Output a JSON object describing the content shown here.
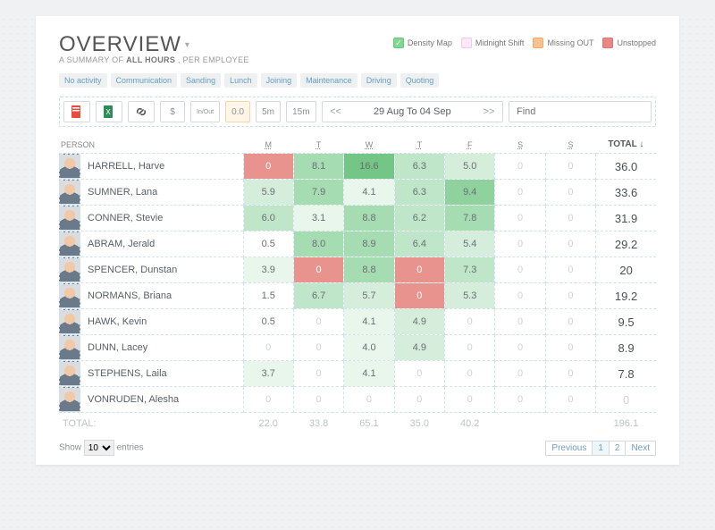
{
  "header": {
    "title": "OVERVIEW",
    "subtitle_pre": "A SUMMARY OF ",
    "subtitle_bold": "ALL HOURS",
    "subtitle_post": ", PER EMPLOYEE"
  },
  "legend": {
    "density": "Density Map",
    "midnight": "Midnight Shift",
    "missing": "Missing OUT",
    "unstopped": "Unstopped"
  },
  "chips": [
    "No activity",
    "Communication",
    "Sanding",
    "Lunch",
    "Joining",
    "Maintenance",
    "Driving",
    "Quoting"
  ],
  "toolbar": {
    "currency": "$",
    "inout": "In/Out",
    "zero": "0.0",
    "five": "5m",
    "fifteen": "15m",
    "prev": "<<",
    "range": "29 Aug To 04 Sep",
    "next": ">>",
    "find_placeholder": "Find"
  },
  "table": {
    "person_header": "PERSON",
    "days": [
      "M",
      "T",
      "W",
      "T",
      "F",
      "S",
      "S"
    ],
    "total_header": "TOTAL",
    "rows": [
      {
        "name": "HARRELL, Harve",
        "cells": [
          "0",
          "8.1",
          "16.6",
          "6.3",
          "5.0",
          "0",
          "0"
        ],
        "flags": [
          "neg",
          "g4",
          "g6",
          "g3",
          "g2",
          "z",
          "z"
        ],
        "total": "36.0"
      },
      {
        "name": "SUMNER, Lana",
        "cells": [
          "5.9",
          "7.9",
          "4.1",
          "6.3",
          "9.4",
          "0",
          "0"
        ],
        "flags": [
          "g2",
          "g4",
          "g1",
          "g3",
          "g5",
          "z",
          "z"
        ],
        "total": "33.6"
      },
      {
        "name": "CONNER, Stevie",
        "cells": [
          "6.0",
          "3.1",
          "8.8",
          "6.2",
          "7.8",
          "0",
          "0"
        ],
        "flags": [
          "g3",
          "g1",
          "g4",
          "g3",
          "g4",
          "z",
          "z"
        ],
        "total": "31.9"
      },
      {
        "name": "ABRAM, Jerald",
        "cells": [
          "0.5",
          "8.0",
          "8.9",
          "6.4",
          "5.4",
          "0",
          "0"
        ],
        "flags": [
          "",
          "g4",
          "g4",
          "g3",
          "g2",
          "z",
          "z"
        ],
        "total": "29.2"
      },
      {
        "name": "SPENCER, Dunstan",
        "cells": [
          "3.9",
          "0",
          "8.8",
          "0",
          "7.3",
          "0",
          "0"
        ],
        "flags": [
          "g1",
          "neg",
          "g4",
          "neg",
          "g3",
          "z",
          "z"
        ],
        "total": "20"
      },
      {
        "name": "NORMANS, Briana",
        "cells": [
          "1.5",
          "6.7",
          "5.7",
          "0",
          "5.3",
          "0",
          "0"
        ],
        "flags": [
          "",
          "g3",
          "g2",
          "neg",
          "g2",
          "z",
          "z"
        ],
        "total": "19.2"
      },
      {
        "name": "HAWK, Kevin",
        "cells": [
          "0.5",
          "0",
          "4.1",
          "4.9",
          "0",
          "0",
          "0"
        ],
        "flags": [
          "",
          "z",
          "g1",
          "g2",
          "z",
          "z",
          "z"
        ],
        "total": "9.5"
      },
      {
        "name": "DUNN, Lacey",
        "cells": [
          "0",
          "0",
          "4.0",
          "4.9",
          "0",
          "0",
          "0"
        ],
        "flags": [
          "z",
          "z",
          "g1",
          "g2",
          "z",
          "z",
          "z"
        ],
        "total": "8.9"
      },
      {
        "name": "STEPHENS, Laila",
        "cells": [
          "3.7",
          "0",
          "4.1",
          "0",
          "0",
          "0",
          "0"
        ],
        "flags": [
          "g1",
          "z",
          "g1",
          "z",
          "z",
          "z",
          "z"
        ],
        "total": "7.8"
      },
      {
        "name": "VONRUDEN, Alesha",
        "cells": [
          "0",
          "0",
          "0",
          "0",
          "0",
          "0",
          "0"
        ],
        "flags": [
          "z",
          "z",
          "z",
          "z",
          "z",
          "z",
          "z"
        ],
        "total": "0"
      }
    ],
    "footer_label": "TOTAL:",
    "footer": [
      "22.0",
      "33.8",
      "65.1",
      "35.0",
      "40.2",
      "",
      "",
      "196.1"
    ]
  },
  "pager": {
    "show": "Show",
    "entries": "entries",
    "page_size": "10",
    "prev": "Previous",
    "next": "Next",
    "pages": [
      "1",
      "2"
    ]
  }
}
